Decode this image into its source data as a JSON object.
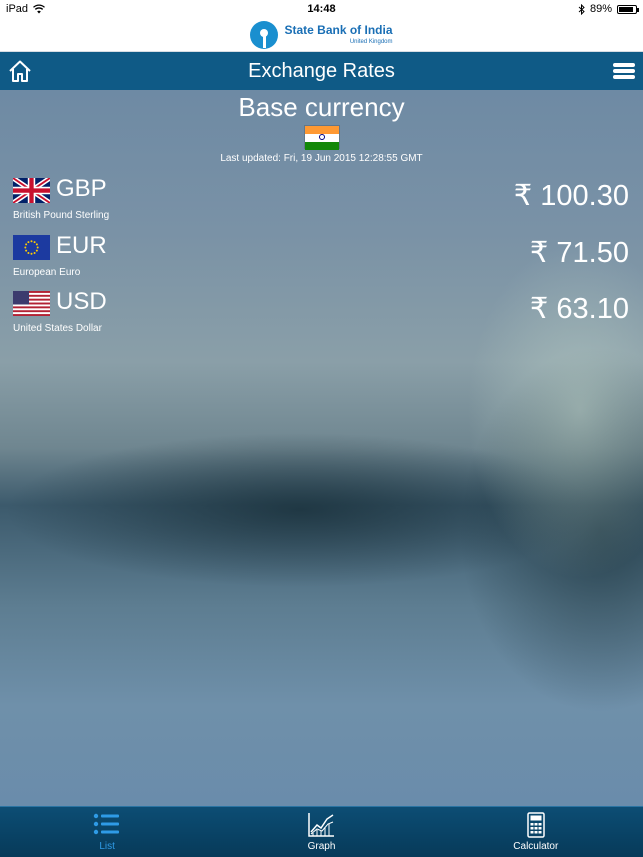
{
  "status_bar": {
    "device": "iPad",
    "time": "14:48",
    "battery": "89%",
    "battery_level": 0.89
  },
  "header": {
    "bank_name": "State Bank of India",
    "bank_region": "United Kingdom",
    "title": "Exchange Rates"
  },
  "base": {
    "title": "Base currency",
    "last_updated": "Last updated: Fri, 19 Jun 2015 12:28:55 GMT"
  },
  "rates": [
    {
      "code": "GBP",
      "name": "British Pound Sterling",
      "rate": "₹ 100.30"
    },
    {
      "code": "EUR",
      "name": "European Euro",
      "rate": "₹ 71.50"
    },
    {
      "code": "USD",
      "name": "United States Dollar",
      "rate": "₹ 63.10"
    }
  ],
  "tabs": [
    {
      "label": "List",
      "icon": "list-icon",
      "active": true
    },
    {
      "label": "Graph",
      "icon": "graph-icon",
      "active": false
    },
    {
      "label": "Calculator",
      "icon": "calculator-icon",
      "active": false
    }
  ],
  "colors": {
    "nav_bar": "#0f5a86",
    "tab_active": "#2f9be6",
    "brand_blue": "#1a8fcf"
  }
}
